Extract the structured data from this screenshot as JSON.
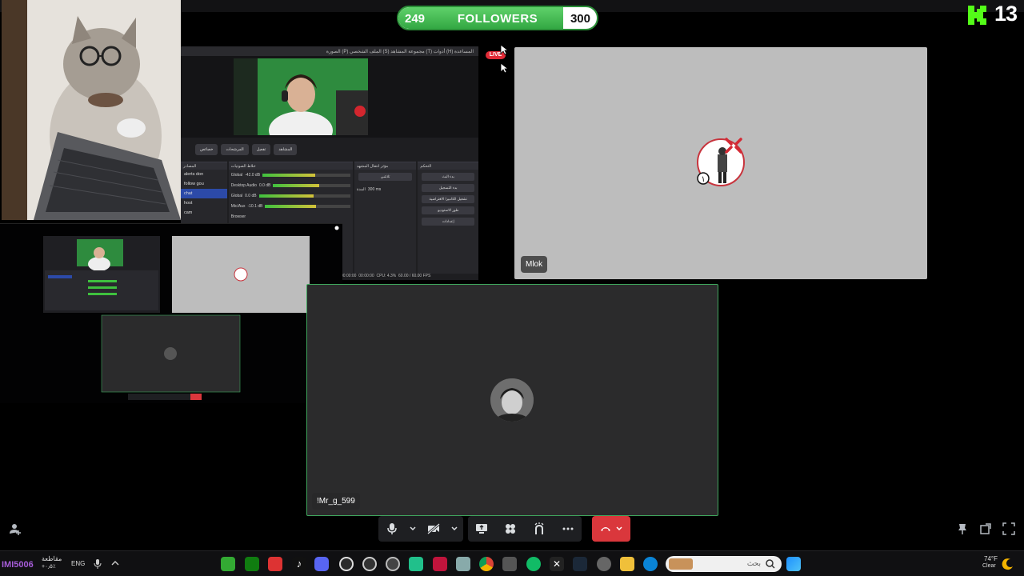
{
  "goal": {
    "current": "249",
    "label": "FOLLOWERS",
    "target": "300",
    "progress_fraction": 0.83
  },
  "kick": {
    "count": "13",
    "accent": "#53fc18"
  },
  "live_badge": "LIVE",
  "obs": {
    "menu": "المساعدة (H)   أدوات (T)   مجموعة المشاهد (S)   الملف الشخصي (P)   الصورة",
    "toolbar": [
      "خصائص",
      "المرشحات",
      "تفعيل",
      "المشاهد"
    ],
    "docks": {
      "sources_title": "المصادر",
      "mixer_title": "خلاط الصوتيات",
      "transitions_title": "مؤثر انتقال المشهد",
      "controls_title": "التحكم"
    },
    "sources": [
      "alerts don",
      "follow gou",
      "chat",
      "host",
      "cam"
    ],
    "mixer": [
      {
        "name": "Global",
        "db": "-42.0 dB"
      },
      {
        "name": "Desktop Audio",
        "db": "0.0 dB"
      },
      {
        "name": "Global",
        "db": "0.0 dB"
      },
      {
        "name": "Mic/Aux",
        "db": "-10.1 dB"
      },
      {
        "name": "Browser",
        "db": ""
      }
    ],
    "transition": {
      "type": "تلاشي",
      "duration_label": "المدة",
      "duration": "300 ms"
    },
    "controls": [
      "بدء البث",
      "بدء التسجيل",
      "تشغيل الكاميرا الافتراضية",
      "طور الاستوديو",
      "إعدادات"
    ],
    "status": {
      "time1": "00:00:00",
      "time2": "00:00:00",
      "cpu": "CPU: 4.3%",
      "fps": "60.00 / 60.00 FPS"
    }
  },
  "call": {
    "participants": [
      {
        "name": "Mlok",
        "tile_color": "#bdbdbd"
      },
      {
        "name": "!Mr_g_599",
        "tile_color": "#2b2b2c",
        "speaking_color": "#3fa55d"
      }
    ],
    "controls": [
      "microphone-icon",
      "camera-off-icon",
      "screen-share-icon",
      "activities-icon",
      "soundboard-icon",
      "more-icon",
      "hangup-icon"
    ]
  },
  "taskbar": {
    "left_text": "IMI5006",
    "stock": "مقاطعة",
    "stock_sub": "+٠٫٥٪",
    "lang": "ENG",
    "search_placeholder": "بحث",
    "weather_temp": "74°F",
    "weather_cond": "Clear"
  }
}
